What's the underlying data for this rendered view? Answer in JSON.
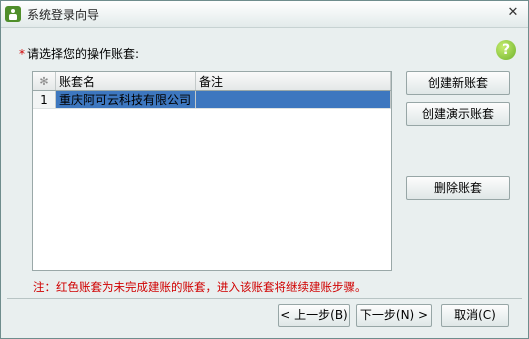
{
  "window": {
    "title": "系统登录向导",
    "close_glyph": "✕"
  },
  "prompt": {
    "required_mark": "*",
    "text": "请选择您的操作账套:"
  },
  "help": {
    "glyph": "?"
  },
  "grid": {
    "corner_glyph": "✻",
    "columns": [
      "账套名",
      "备注"
    ],
    "rows": [
      {
        "num": "1",
        "name": "重庆阿可云科技有限公司",
        "remark": ""
      }
    ]
  },
  "side_buttons": {
    "create_new": "创建新账套",
    "create_demo": "创建演示账套",
    "delete": "删除账套"
  },
  "note": "注：红色账套为未完成建账的账套，进入该账套将继续建账步骤。",
  "bottom_buttons": {
    "prev": "< 上一步(B)",
    "next": "下一步(N) >",
    "cancel": "取消(C)"
  }
}
